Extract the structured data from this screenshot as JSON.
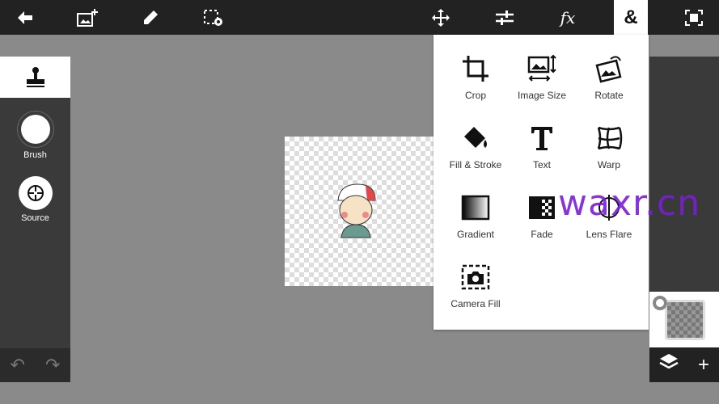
{
  "topbar": {
    "icons": [
      "back-arrow-icon",
      "add-image-icon",
      "pencil-icon",
      "selection-settings-icon",
      "move-icon",
      "adjustments-icon",
      "fx-icon",
      "ampersand-icon",
      "fullscreen-icon"
    ],
    "fx_label": "fx",
    "amp_label": "&"
  },
  "left_panel": {
    "tool_icon": "stamp-icon",
    "brush_label": "Brush",
    "source_label": "Source",
    "undo_icon": "undo-icon",
    "redo_icon": "redo-icon"
  },
  "menu": {
    "items": [
      {
        "label": "Crop",
        "icon": "crop-icon"
      },
      {
        "label": "Image Size",
        "icon": "image-size-icon"
      },
      {
        "label": "Rotate",
        "icon": "rotate-icon"
      },
      {
        "label": "Fill & Stroke",
        "icon": "fill-bucket-icon"
      },
      {
        "label": "Text",
        "icon": "text-icon"
      },
      {
        "label": "Warp",
        "icon": "warp-icon"
      },
      {
        "label": "Gradient",
        "icon": "gradient-icon"
      },
      {
        "label": "Fade",
        "icon": "fade-icon"
      },
      {
        "label": "Lens Flare",
        "icon": "lens-flare-icon"
      },
      {
        "label": "Camera Fill",
        "icon": "camera-fill-icon"
      }
    ]
  },
  "right_panel": {
    "layers_icon": "layers-icon",
    "add_icon": "plus-icon",
    "add_label": "+"
  },
  "watermark": "waxr.cn",
  "colors": {
    "topbar": "#222222",
    "panel": "#3a3a3a",
    "workspace": "#8a8a8a",
    "watermark": "#7a1fd6"
  }
}
